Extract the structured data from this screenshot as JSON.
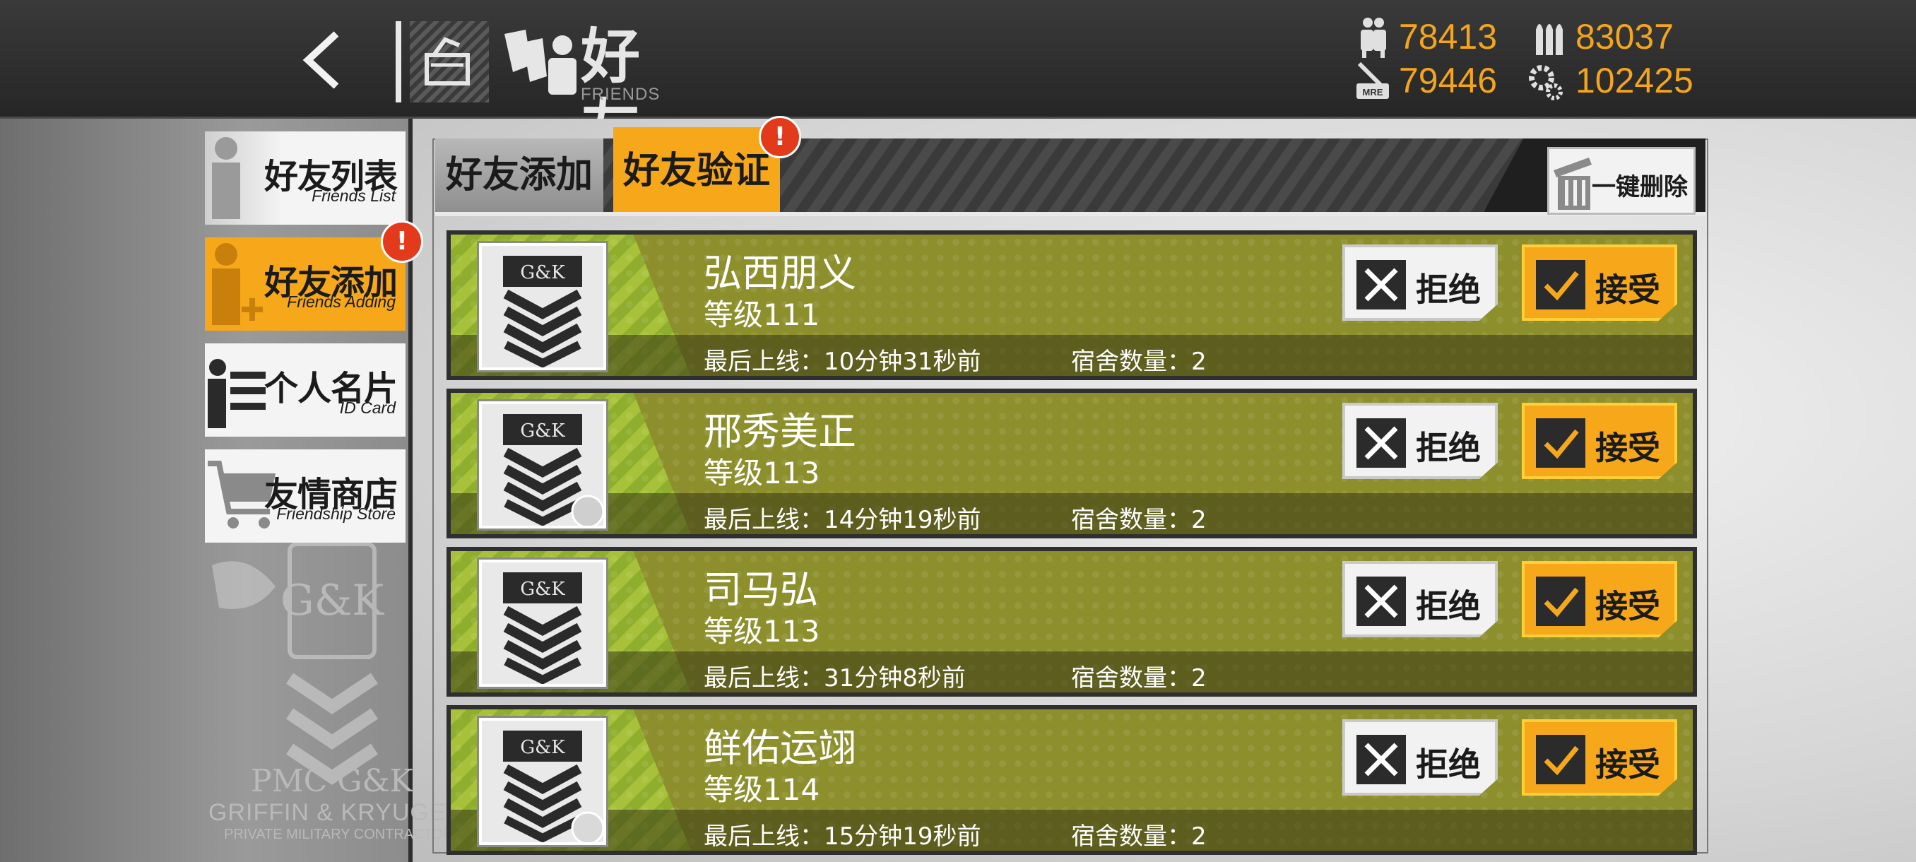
{
  "header": {
    "title": "好友",
    "subtitle": "FRIENDS",
    "resources": [
      {
        "icon": "manpower-icon",
        "value": "78413"
      },
      {
        "icon": "ammo-icon",
        "value": "83037"
      },
      {
        "icon": "rations-icon",
        "value": "79446",
        "icon_label": "MRE"
      },
      {
        "icon": "parts-icon",
        "value": "102425"
      }
    ]
  },
  "sidebar": {
    "items": [
      {
        "zh": "好友列表",
        "en": "Friends List",
        "active": false
      },
      {
        "zh": "好友添加",
        "en": "Friends Adding",
        "active": true,
        "badge": "!"
      },
      {
        "zh": "个人名片",
        "en": "ID Card",
        "active": false
      },
      {
        "zh": "友情商店",
        "en": "Friendship Store",
        "active": false
      }
    ]
  },
  "tabs": [
    {
      "label": "好友添加",
      "active": false
    },
    {
      "label": "好友验证",
      "active": true,
      "badge": "!"
    }
  ],
  "delete_all_label": "一键删除",
  "watermark": {
    "line1": "PMC G&K",
    "line2": "GRIFFIN & KRYUGER",
    "line3": "PRIVATE MILITARY CONTRACTOR"
  },
  "requests": [
    {
      "name": "弘西朋义",
      "level": "等级111",
      "last_online": "最后上线：10分钟31秒前",
      "dorm": "宿舍数量：2",
      "reject": "拒绝",
      "accept": "接受"
    },
    {
      "name": "邢秀美正",
      "level": "等级113",
      "last_online": "最后上线：14分钟19秒前",
      "dorm": "宿舍数量：2",
      "reject": "拒绝",
      "accept": "接受"
    },
    {
      "name": "司马弘",
      "level": "等级113",
      "last_online": "最后上线：31分钟8秒前",
      "dorm": "宿舍数量：2",
      "reject": "拒绝",
      "accept": "接受"
    },
    {
      "name": "鲜佑运翊",
      "level": "等级114",
      "last_online": "最后上线：15分钟19秒前",
      "dorm": "宿舍数量：2",
      "reject": "拒绝",
      "accept": "接受"
    }
  ],
  "colors": {
    "accent": "#f7a81a",
    "resource": "#f3a51b",
    "card": "#8d8f2c",
    "badge": "#e43a1c"
  }
}
